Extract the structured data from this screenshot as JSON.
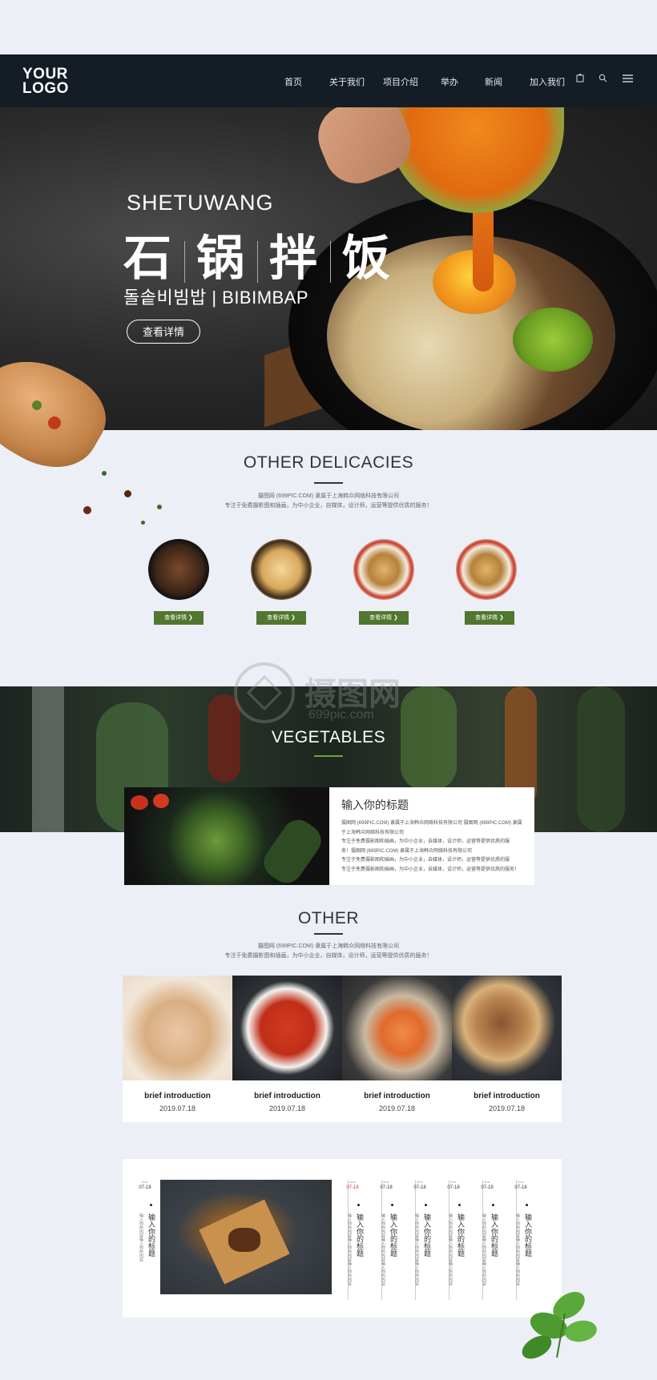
{
  "nav": {
    "logo_line1": "YOUR",
    "logo_line2": "LOGO",
    "items": [
      "首页",
      "关于我们",
      "项目介绍",
      "举办",
      "新闻",
      "加入我们"
    ],
    "icons": [
      "bag-icon",
      "search-icon",
      "menu-icon"
    ]
  },
  "hero": {
    "subtitle": "SHETUWANG",
    "title_chars": [
      "石",
      "锅",
      "拌",
      "饭"
    ],
    "tagline": "돌솥비빔밥 | BIBIMBAP",
    "button": "查看详情"
  },
  "delicacies": {
    "title": "OTHER DELICACIES",
    "desc_line1": "摄图网 (699PIC.COM) 隶属于上海韩众网络科技有限公司",
    "desc_line2": "专注于免费摄影图和插画，为中小企业，自媒体，设计师，运营等提供优质的服务！",
    "button": "查看详情 ❯"
  },
  "watermark": {
    "cn": "摄图网",
    "url": "699pic.com"
  },
  "vegetables": {
    "title": "VEGETABLES",
    "card_title": "输入你的标题",
    "card_lines": [
      "摄图网 (699PIC.COM) 隶属于上海韩众网络科技有限公司 摄图网 (699PIC.COM) 隶属",
      "于上海韩众网络科技有限公司",
      "专注于免费摄影图和插画，为中小企业，自媒体，设计师，运营等提供优质的服",
      "务！摄图网 (699PIC.COM) 隶属于上海韩众网络科技有限公司",
      "专注于免费摄影图和插画，为中小企业，自媒体，设计师，运营等提供优质的服",
      "专注于免费摄影图和插画，为中小企业，自媒体，设计师，运营等提供优质的服务！"
    ]
  },
  "other": {
    "title": "OTHER",
    "desc_line1": "摄图网 (699PIC.COM) 隶属于上海韩众网络科技有限公司",
    "desc_line2": "专注于免费摄影图和插画，为中小企业，自媒体，设计师，运营等提供优质的服务！",
    "cards": [
      {
        "title": "brief introduction",
        "date": "2019.07.18"
      },
      {
        "title": "brief introduction",
        "date": "2019.07.18"
      },
      {
        "title": "brief introduction",
        "date": "2019.07.18"
      },
      {
        "title": "brief introduction",
        "date": "2019.07.18"
      }
    ]
  },
  "timeline": {
    "small": "time",
    "main": {
      "date": "07-18",
      "head": "输入你的标题",
      "body": "输入你的内容输入你的内容"
    },
    "items": [
      {
        "date": "07-18",
        "head": "输入你的标题",
        "body": "输入你的内容输入你的内容输入你的内容"
      },
      {
        "date": "07-18",
        "head": "输入你的标题",
        "body": "输入你的内容输入你的内容输入你的内容"
      },
      {
        "date": "07-18",
        "head": "输入你的标题",
        "body": "输入你的内容输入你的内容输入你的内容"
      },
      {
        "date": "07-18",
        "head": "输入你的标题",
        "body": "输入你的内容输入你的内容输入你的内容"
      },
      {
        "date": "07-18",
        "head": "输入你的标题",
        "body": "输入你的内容输入你的内容输入你的内容"
      },
      {
        "date": "07-18",
        "head": "输入你的标题",
        "body": "输入你的内容输入你的内容输入你的内容"
      }
    ]
  },
  "colors": {
    "nav_bg": "#141c26",
    "page_bg": "#eceff6",
    "accent_green": "#51762e",
    "timeline_red": "#e0302c"
  }
}
